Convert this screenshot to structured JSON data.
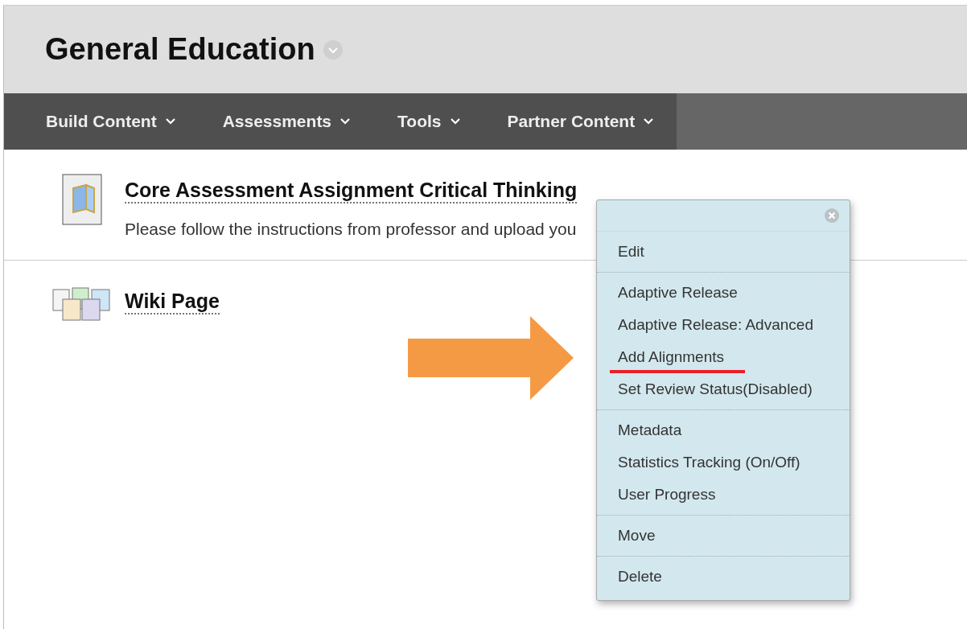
{
  "page": {
    "title": "General Education"
  },
  "nav": [
    {
      "label": "Build Content"
    },
    {
      "label": "Assessments"
    },
    {
      "label": "Tools"
    },
    {
      "label": "Partner Content"
    }
  ],
  "items": [
    {
      "kind": "assignment",
      "title": "Core Assessment Assignment Critical Thinking",
      "description": "Please follow the instructions from professor and upload you"
    },
    {
      "kind": "wiki",
      "title": "Wiki Page"
    }
  ],
  "context_menu": {
    "groups": [
      [
        {
          "label": "Edit",
          "underlined": false
        }
      ],
      [
        {
          "label": "Adaptive Release",
          "underlined": false
        },
        {
          "label": "Adaptive Release: Advanced",
          "underlined": false
        },
        {
          "label": "Add Alignments",
          "underlined": true
        },
        {
          "label": "Set Review Status(Disabled)",
          "underlined": false
        }
      ],
      [
        {
          "label": "Metadata",
          "underlined": false
        },
        {
          "label": "Statistics Tracking (On/Off)",
          "underlined": false
        },
        {
          "label": "User Progress",
          "underlined": false
        }
      ],
      [
        {
          "label": "Move",
          "underlined": false
        }
      ],
      [
        {
          "label": "Delete",
          "underlined": false
        }
      ]
    ]
  }
}
